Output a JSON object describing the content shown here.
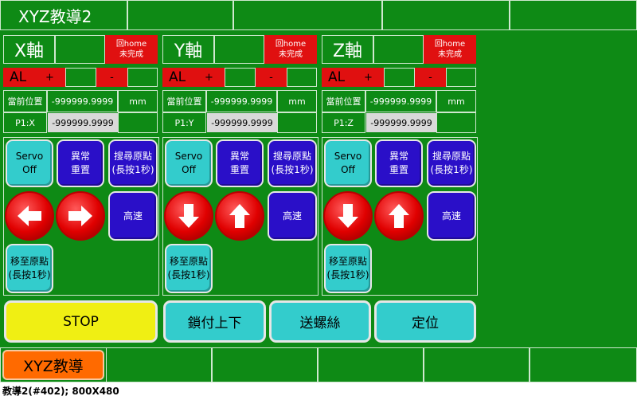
{
  "header": {
    "title": "XYZ教導2"
  },
  "axes": [
    {
      "name": "X軸",
      "home_line1": "回home",
      "home_line2": "未完成",
      "al": "AL",
      "plus": "+",
      "minus": "-",
      "pos_label": "當前位置",
      "pos_value": "-999999.9999",
      "unit": "mm",
      "p1_label": "P1:X",
      "p1_value": "-999999.9999",
      "servo_line1": "Servo",
      "servo_line2": "Off",
      "reset_line1": "異常",
      "reset_line2": "重置",
      "search_line1": "搜尋原點",
      "search_line2": "(長按1秒)",
      "arrow_left_icon": "left-arrow-icon",
      "arrow_right_icon": "right-arrow-icon",
      "speed": "高速",
      "move_line1": "移至原點",
      "move_line2": "(長按1秒)"
    },
    {
      "name": "Y軸",
      "home_line1": "回home",
      "home_line2": "未完成",
      "al": "AL",
      "plus": "+",
      "minus": "-",
      "pos_label": "當前位置",
      "pos_value": "-999999.9999",
      "unit": "mm",
      "p1_label": "P1:Y",
      "p1_value": "-999999.9999",
      "servo_line1": "Servo",
      "servo_line2": "Off",
      "reset_line1": "異常",
      "reset_line2": "重置",
      "search_line1": "搜尋原點",
      "search_line2": "(長按1秒)",
      "arrow_left_icon": "down-arrow-icon",
      "arrow_right_icon": "up-arrow-icon",
      "speed": "高速",
      "move_line1": "移至原點",
      "move_line2": "(長按1秒)"
    },
    {
      "name": "Z軸",
      "home_line1": "回home",
      "home_line2": "未完成",
      "al": "AL",
      "plus": "+",
      "minus": "-",
      "pos_label": "當前位置",
      "pos_value": "-999999.9999",
      "unit": "mm",
      "p1_label": "P1:Z",
      "p1_value": "-999999.9999",
      "servo_line1": "Servo",
      "servo_line2": "Off",
      "reset_line1": "異常",
      "reset_line2": "重置",
      "search_line1": "搜尋原點",
      "search_line2": "(長按1秒)",
      "arrow_left_icon": "down-arrow-icon",
      "arrow_right_icon": "up-arrow-icon",
      "speed": "高速",
      "move_line1": "移至原點",
      "move_line2": "(長按1秒)"
    }
  ],
  "actions": {
    "stop": "STOP",
    "lock": "鎖付上下",
    "feed": "送螺絲",
    "position": "定位"
  },
  "nav": {
    "teach": "XYZ教導"
  },
  "footer": {
    "caption": "教導2(#402); 800X480"
  },
  "colors": {
    "background": "#0e8a15",
    "alarm_red": "#e01010",
    "cyan": "#33cccc",
    "blue": "#2a0fc8",
    "stop_yellow": "#f0ef13",
    "nav_orange": "#ff6a00"
  }
}
